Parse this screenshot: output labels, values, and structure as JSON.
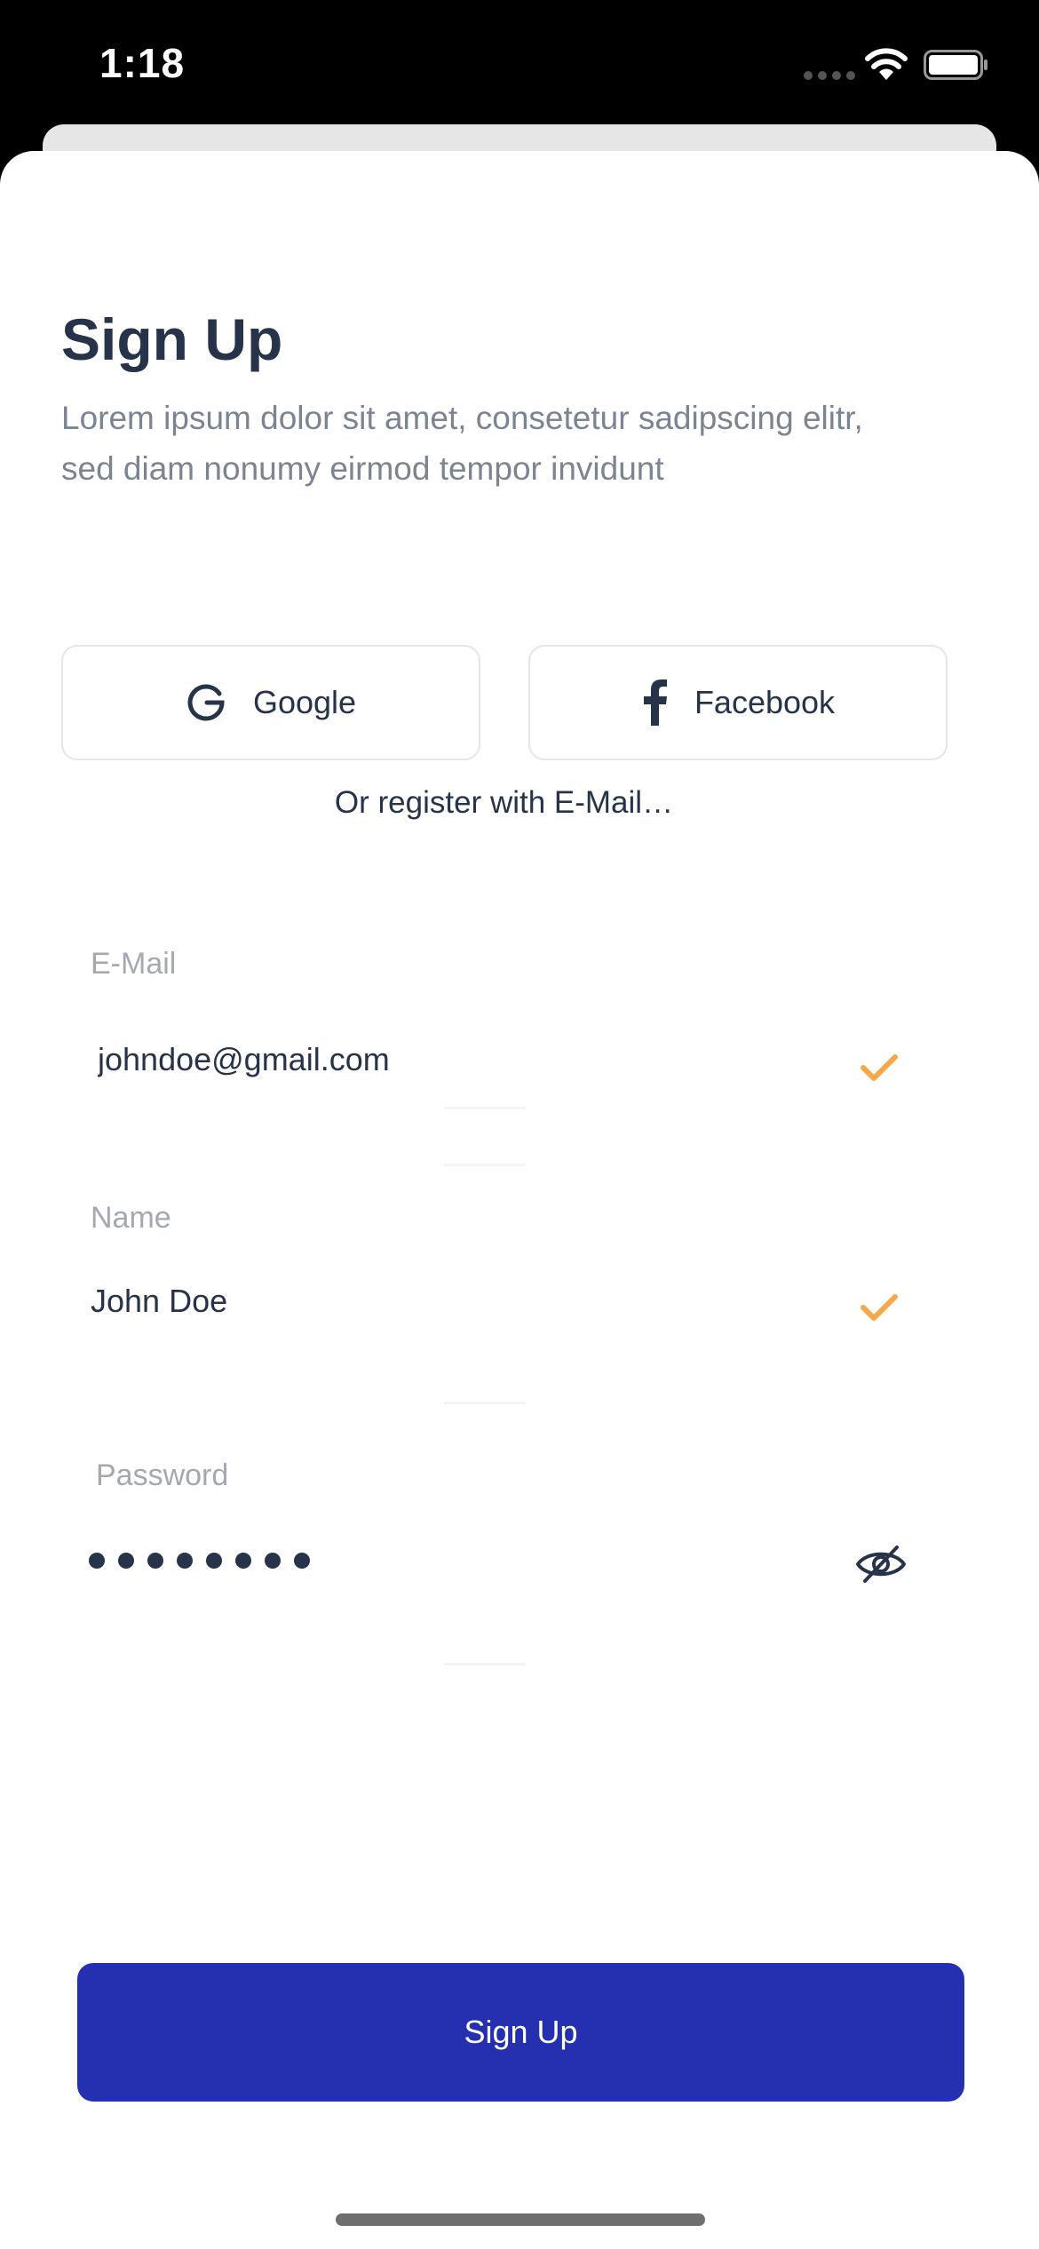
{
  "status_bar": {
    "time": "1:18"
  },
  "header": {
    "title": "Sign Up",
    "subtitle": "Lorem ipsum dolor sit amet, consetetur sadipscing elitr, sed diam nonumy eirmod tempor invidunt"
  },
  "social": {
    "google_label": "Google",
    "facebook_label": "Facebook",
    "divider_text": "Or register with E-Mail…"
  },
  "form": {
    "email": {
      "label": "E-Mail",
      "value": "johndoe@gmail.com",
      "valid": true
    },
    "name": {
      "label": "Name",
      "value": "John Doe",
      "valid": true
    },
    "password": {
      "label": "Password",
      "masked_length": 8,
      "visibility_icon": "eye-slash-icon"
    }
  },
  "submit": {
    "label": "Sign Up"
  },
  "colors": {
    "primary": "#2430b0",
    "text_dark": "#263348",
    "text_muted": "#7b8491",
    "label": "#a3a8b1",
    "check": "#f3a94a"
  }
}
